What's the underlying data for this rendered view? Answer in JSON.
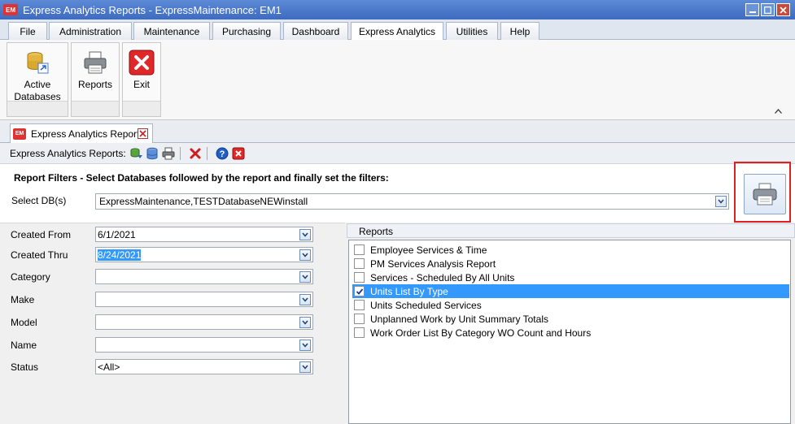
{
  "window": {
    "title": "Express Analytics Reports - ExpressMaintenance: EM1",
    "app_icon_text": "EM"
  },
  "menu": {
    "tabs": [
      {
        "label": "File"
      },
      {
        "label": "Administration"
      },
      {
        "label": "Maintenance"
      },
      {
        "label": "Purchasing"
      },
      {
        "label": "Dashboard"
      },
      {
        "label": "Express Analytics"
      },
      {
        "label": "Utilities"
      },
      {
        "label": "Help"
      }
    ],
    "active": "Express Analytics"
  },
  "ribbon": {
    "active_databases_line1": "Active",
    "active_databases_line2": "Databases",
    "reports_label": "Reports",
    "exit_label": "Exit"
  },
  "document_tab": {
    "label": "Express Analytics Reports"
  },
  "toolbar": {
    "label": "Express Analytics Reports:"
  },
  "filters": {
    "heading": "Report Filters - Select Databases followed by the report and finally set the filters:",
    "select_db_label": "Select DB(s)",
    "select_db_value": "ExpressMaintenance,TESTDatabaseNEWinstall",
    "fields": {
      "created_from": {
        "label": "Created From",
        "value": "6/1/2021"
      },
      "created_thru": {
        "label": "Created Thru",
        "value": "8/24/2021"
      },
      "category": {
        "label": "Category",
        "value": ""
      },
      "make": {
        "label": "Make",
        "value": ""
      },
      "model": {
        "label": "Model",
        "value": ""
      },
      "name": {
        "label": "Name",
        "value": ""
      },
      "status": {
        "label": "Status",
        "value": "<All>"
      }
    }
  },
  "reports": {
    "header": "Reports",
    "items": [
      {
        "label": "Employee Services & Time",
        "checked": false
      },
      {
        "label": "PM Services Analysis Report",
        "checked": false
      },
      {
        "label": "Services - Scheduled By All Units",
        "checked": false
      },
      {
        "label": "Units List By Type",
        "checked": true
      },
      {
        "label": "Units Scheduled Services",
        "checked": false
      },
      {
        "label": "Unplanned Work by Unit Summary Totals",
        "checked": false
      },
      {
        "label": "Work Order List By Category WO Count and Hours",
        "checked": false
      }
    ]
  },
  "colors": {
    "selection": "#3399ff",
    "highlight_border": "#e02020",
    "titlebar": "#4a78c8"
  }
}
